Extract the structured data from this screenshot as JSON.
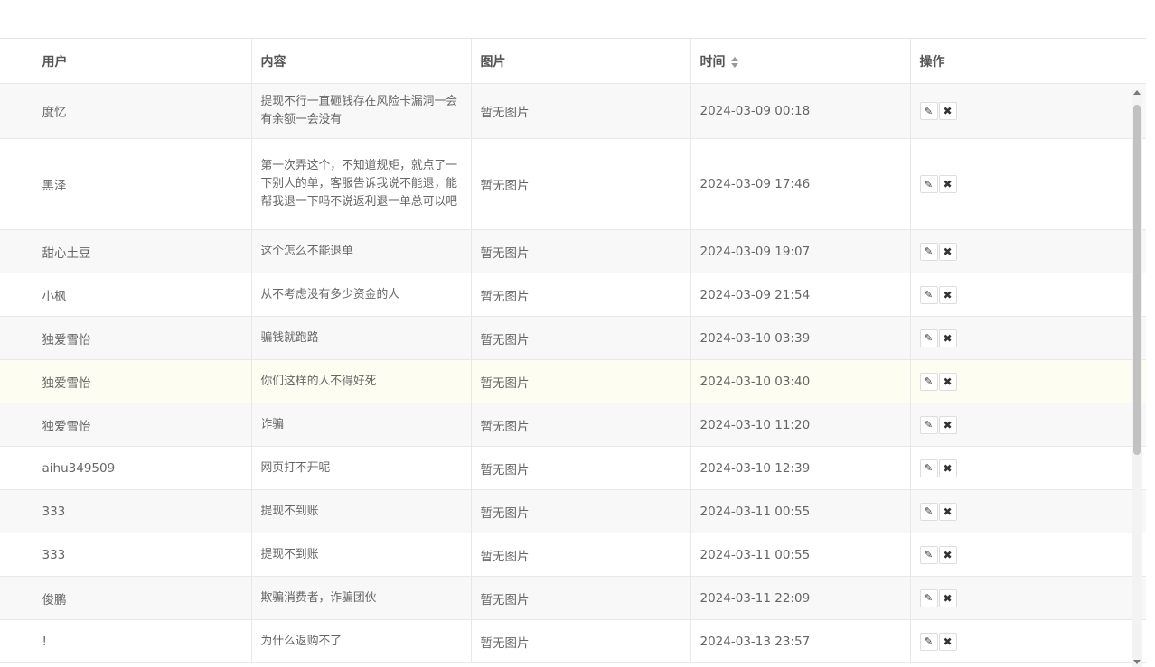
{
  "table": {
    "headers": {
      "user": "用户",
      "content": "内容",
      "image": "图片",
      "time": "时间",
      "actions": "操作"
    },
    "rows": [
      {
        "user": "度忆",
        "content": "提现不行一直砸钱存在风险卡漏洞一会有余额一会没有",
        "image": "暂无图片",
        "time": "2024-03-09 00:18"
      },
      {
        "user": "黑泽",
        "content": "第一次弄这个，不知道规矩，就点了一下别人的单，客服告诉我说不能退，能帮我退一下吗不说返利退一单总可以吧",
        "image": "暂无图片",
        "time": "2024-03-09 17:46"
      },
      {
        "user": "甜心土豆",
        "content": "这个怎么不能退单",
        "image": "暂无图片",
        "time": "2024-03-09 19:07"
      },
      {
        "user": "小枫",
        "content": "从不考虑没有多少资金的人",
        "image": "暂无图片",
        "time": "2024-03-09 21:54"
      },
      {
        "user": "独爱雪怡",
        "content": "骗钱就跑路",
        "image": "暂无图片",
        "time": "2024-03-10 03:39"
      },
      {
        "user": "独爱雪怡",
        "content": "你们这样的人不得好死",
        "image": "暂无图片",
        "time": "2024-03-10 03:40"
      },
      {
        "user": "独爱雪怡",
        "content": "诈骗",
        "image": "暂无图片",
        "time": "2024-03-10 11:20"
      },
      {
        "user": "aihu349509",
        "content": "网页打不开呢",
        "image": "暂无图片",
        "time": "2024-03-10 12:39"
      },
      {
        "user": "333",
        "content": "提现不到账",
        "image": "暂无图片",
        "time": "2024-03-11 00:55"
      },
      {
        "user": "333",
        "content": "提现不到账",
        "image": "暂无图片",
        "time": "2024-03-11 00:55"
      },
      {
        "user": "俊鹏",
        "content": "欺骗消费者，诈骗团伙",
        "image": "暂无图片",
        "time": "2024-03-11 22:09"
      },
      {
        "user": "!",
        "content": "为什么返购不了",
        "image": "暂无图片",
        "time": "2024-03-13 23:57"
      }
    ]
  },
  "icons": {
    "edit": "pencil-icon",
    "delete": "close-icon",
    "sort": "sort-icon"
  }
}
